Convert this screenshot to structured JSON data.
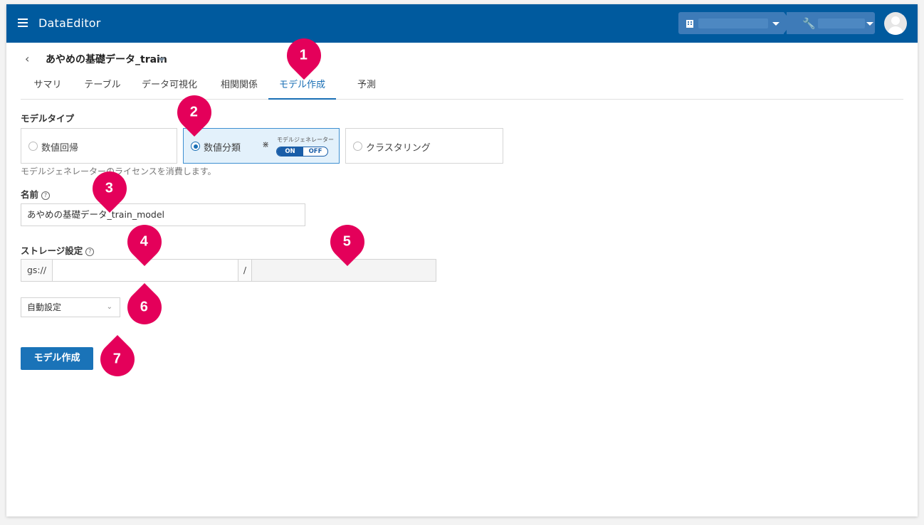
{
  "app": {
    "title": "DataEditor"
  },
  "dataset": {
    "name": "あやめの基礎データ_train"
  },
  "tabs": [
    {
      "label": "サマリ"
    },
    {
      "label": "テーブル"
    },
    {
      "label": "データ可視化"
    },
    {
      "label": "相関関係"
    },
    {
      "label": "モデル作成",
      "active": true
    },
    {
      "label": "予測"
    }
  ],
  "model_type": {
    "label": "モデルタイプ",
    "options": [
      {
        "label": "数値回帰",
        "selected": false
      },
      {
        "label": "数値分類",
        "selected": true
      },
      {
        "label": "クラスタリング",
        "selected": false
      }
    ],
    "generator_label": "モデルジェネレーター",
    "toggle_on": "ON",
    "toggle_off": "OFF",
    "hint": "モデルジェネレーターのライセンスを消費します。"
  },
  "name_field": {
    "label": "名前",
    "value": "あやめの基礎データ_train_model"
  },
  "storage": {
    "label": "ストレージ設定",
    "prefix": "gs://",
    "separator": "/",
    "bucket": "",
    "path": ""
  },
  "auto_select": {
    "value": "自動設定"
  },
  "create_button": {
    "label": "モデル作成"
  },
  "markers": [
    "1",
    "2",
    "3",
    "4",
    "5",
    "6",
    "7"
  ],
  "colors": {
    "appbar": "#005a9e",
    "accent": "#1a73b8",
    "marker": "#e4005a"
  }
}
